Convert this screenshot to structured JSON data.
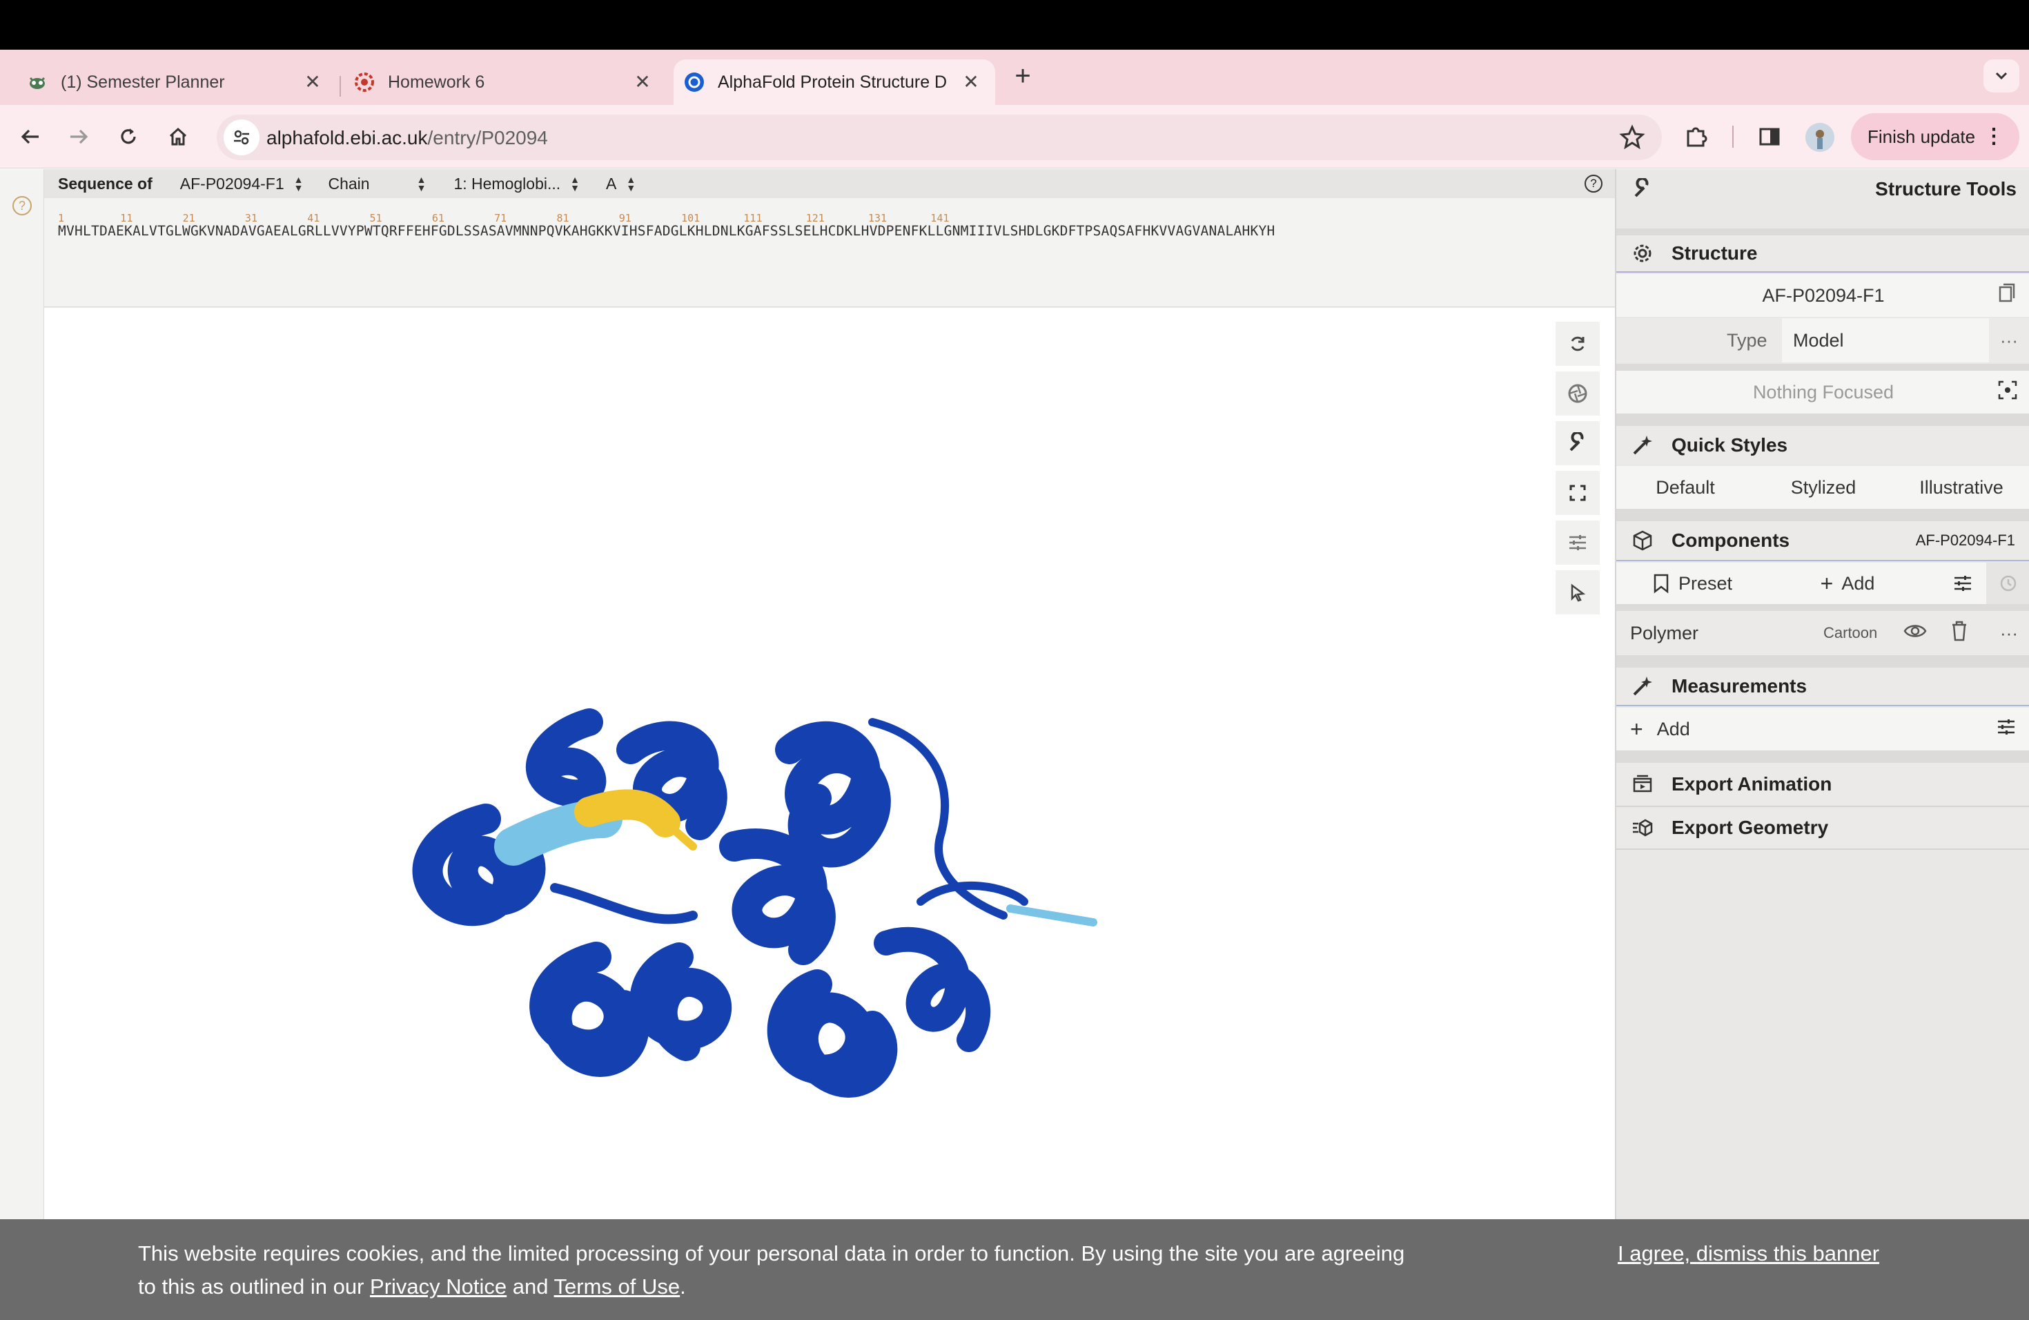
{
  "browser": {
    "tabs": [
      {
        "title": "(1) Semester Planner",
        "icon": "alien-icon"
      },
      {
        "title": "Homework 6",
        "icon": "gear-red-icon"
      },
      {
        "title": "AlphaFold Protein Structure D",
        "icon": "alphafold-icon",
        "active": true
      }
    ],
    "url_host": "alphafold.ebi.ac.uk",
    "url_path": "/entry/P02094",
    "finish_update": "Finish update"
  },
  "sequence": {
    "label": "Sequence of",
    "entry": "AF-P02094-F1",
    "chain_label": "Chain",
    "entity": "1: Hemoglobi...",
    "chain": "A",
    "numbers": "1         11        21        31        41        51        61        71        81        91        101       111       121       131       141",
    "residues": "MVHLTDAEKALVTGLWGKVNADAVGAEALGRLLVVYPWTQRFFEHFGDLSSASAVMNNPQVKAHGKKVIHSFADGLKHLDNLKGAFSSLSELHCDKLHVDPENFKLLGNMIIIVLSHDLGKDFTPSAQSAFHKVVAGVANALAHKYH"
  },
  "panel": {
    "title": "Structure Tools",
    "structure": {
      "heading": "Structure",
      "name": "AF-P02094-F1",
      "type_label": "Type",
      "type_value": "Model",
      "focus": "Nothing Focused"
    },
    "quick_styles": {
      "heading": "Quick Styles",
      "options": [
        "Default",
        "Stylized",
        "Illustrative"
      ]
    },
    "components": {
      "heading": "Components",
      "entry": "AF-P02094-F1",
      "preset": "Preset",
      "add": "Add",
      "polymer": "Polymer",
      "polymer_repr": "Cartoon"
    },
    "measurements": {
      "heading": "Measurements",
      "add": "Add"
    },
    "export_animation": "Export Animation",
    "export_geometry": "Export Geometry"
  },
  "cookie": {
    "text1": "This website requires cookies, and the limited processing of your personal data in order to function. By using the site you are agreeing to this as outlined in our ",
    "privacy": "Privacy Notice",
    "and": " and ",
    "terms": "Terms of Use",
    "end": ".",
    "agree": "I agree, dismiss this banner"
  },
  "colors": {
    "protein_main": "#1540b0",
    "protein_yellow": "#f0c52f",
    "protein_light": "#79c3e6"
  }
}
